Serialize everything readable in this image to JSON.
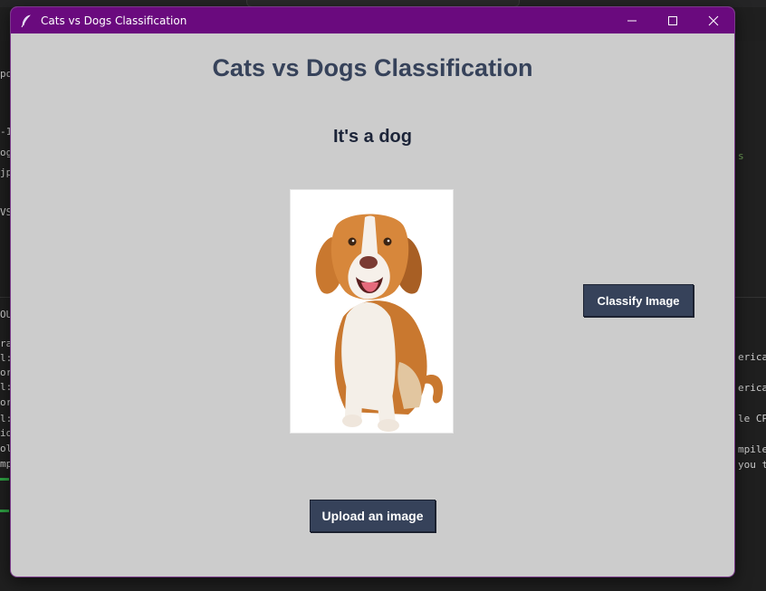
{
  "window": {
    "title": "Cats vs Dogs Classification"
  },
  "app": {
    "heading": "Cats vs Dogs Classification",
    "result": "It's a dog",
    "classify_label": "Classify Image",
    "upload_label": "Upload an image",
    "image_alt": "dog"
  },
  "background_terminal": {
    "left_lines": [
      "po",
      "-1",
      "og",
      "jp",
      "VS",
      "OU",
      "ra",
      "l:",
      "or",
      "l:",
      "or",
      "l:",
      "io",
      "ol",
      "mp"
    ],
    "right_lines": [
      "s",
      "erical",
      "erical",
      "le CPU",
      "mpiler",
      "you tr"
    ]
  },
  "colors": {
    "titlebar": "#6a0a7e",
    "window_bg": "#cccccc",
    "button_bg": "#36425a",
    "heading_text": "#36425a"
  }
}
